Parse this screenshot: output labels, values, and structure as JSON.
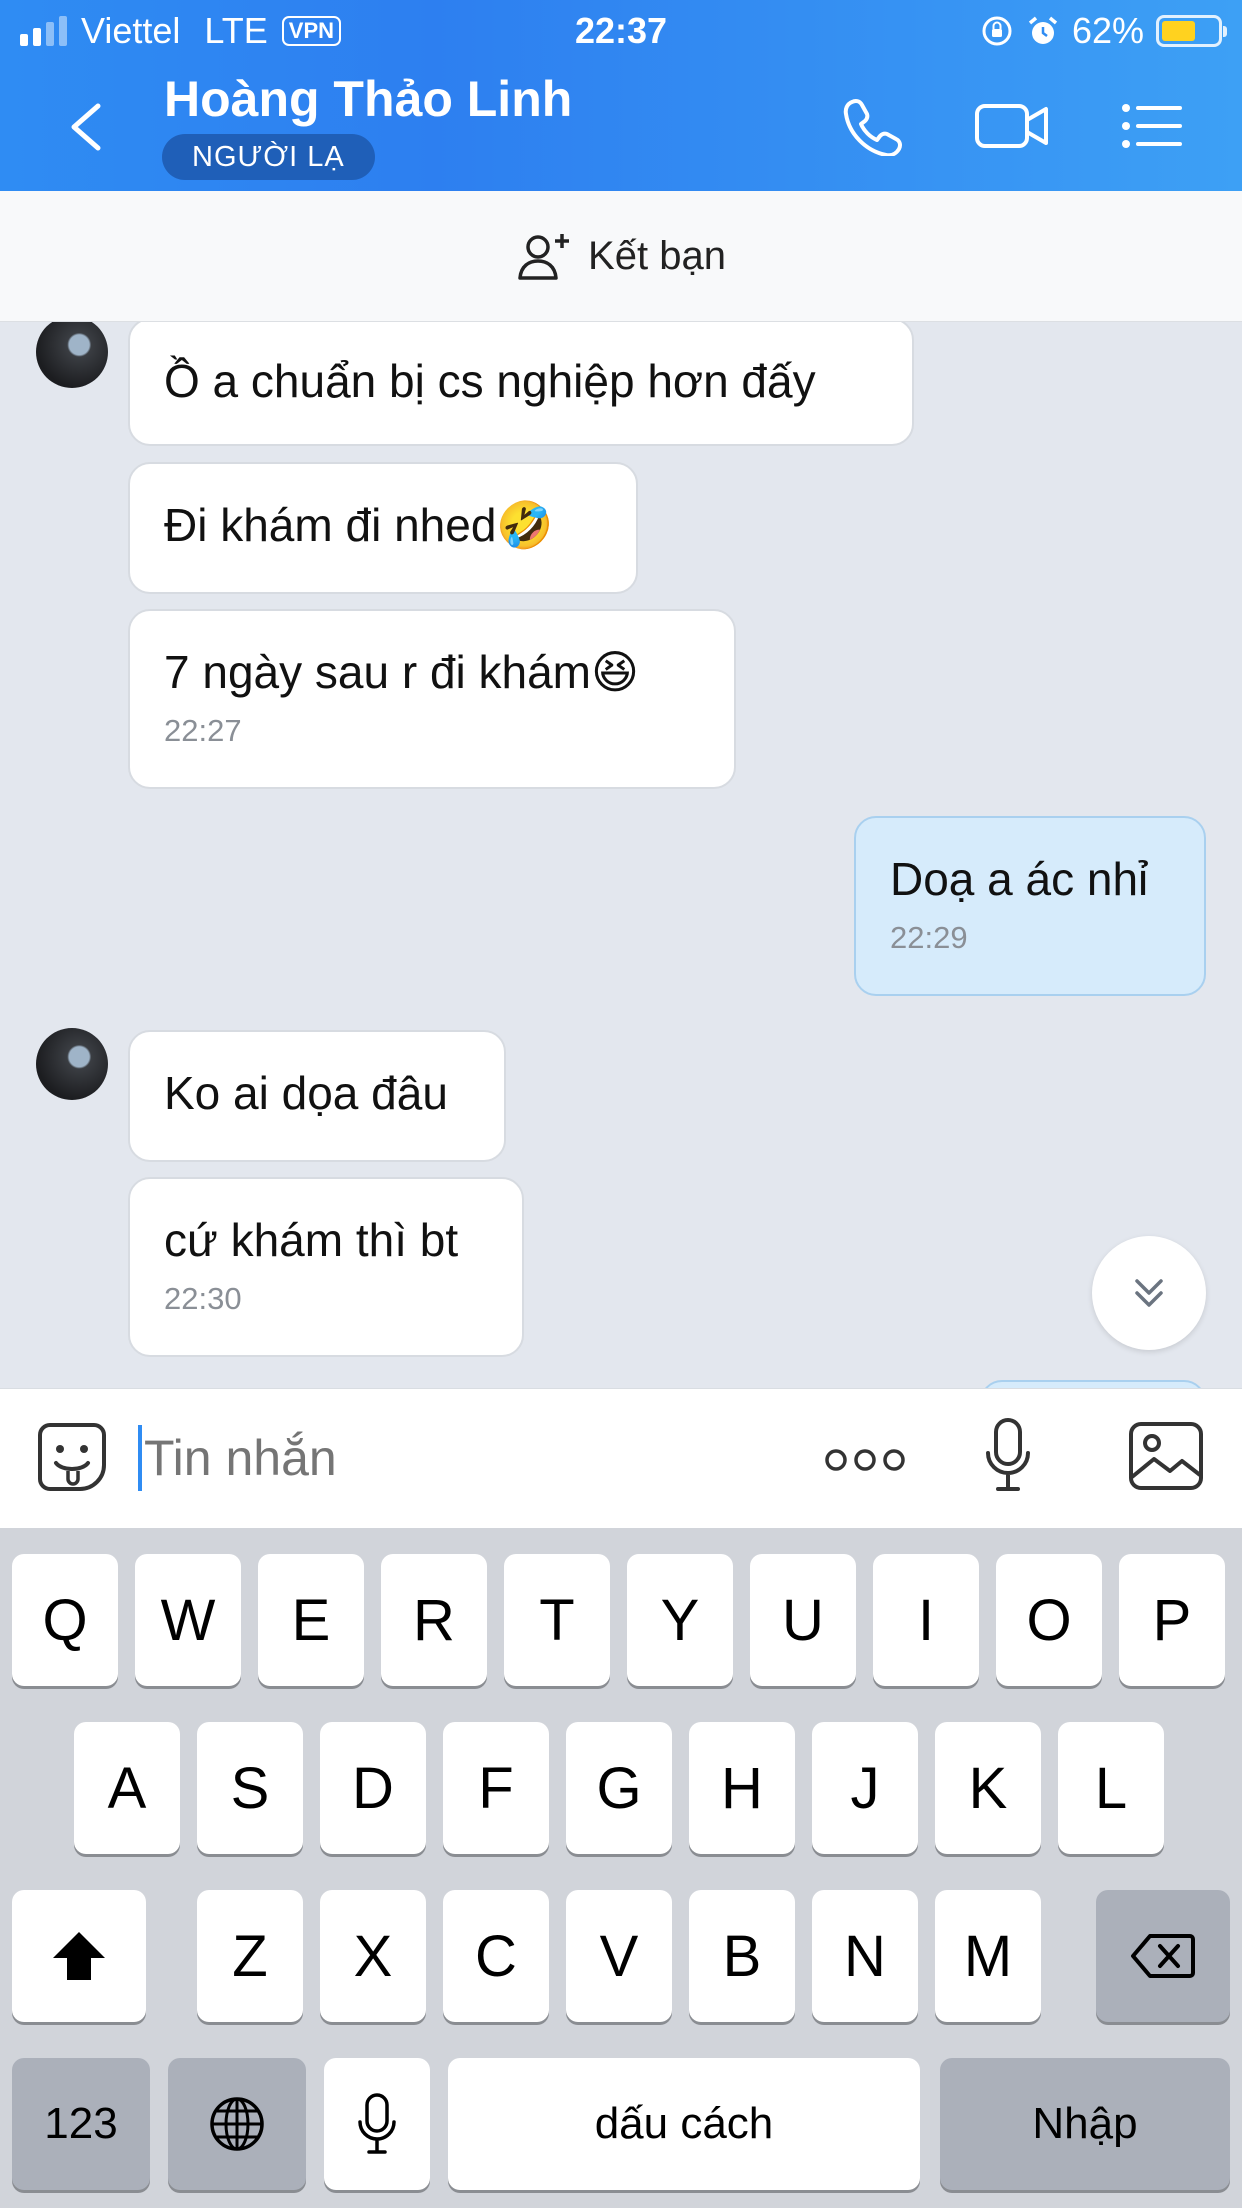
{
  "status_bar": {
    "carrier": "Viettel",
    "network": "LTE",
    "vpn": "VPN",
    "time": "22:37",
    "battery": "62%",
    "battery_level": 0.62
  },
  "header": {
    "contact_name": "Hoàng Thảo Linh",
    "badge": "NGƯỜI LẠ",
    "icons": [
      "back-icon",
      "phone-icon",
      "video-call-icon",
      "menu-list-icon"
    ]
  },
  "add_friend": {
    "label": "Kết bạn",
    "icon": "add-person-icon"
  },
  "messages": [
    {
      "sender": "them",
      "text": "Ồ a chuẩn bị cs nghiệp hơn đấy",
      "time": ""
    },
    {
      "sender": "them",
      "text": "Đi khám đi nhed🤣",
      "time": ""
    },
    {
      "sender": "them",
      "text": "7 ngày sau r đi khám😆",
      "time": "22:27"
    },
    {
      "sender": "me",
      "text": "Doạ a ác nhỉ",
      "time": "22:29"
    },
    {
      "sender": "them",
      "text": "Ko ai dọa đâu",
      "time": ""
    },
    {
      "sender": "them",
      "text": "cứ khám thì bt",
      "time": "22:30"
    }
  ],
  "input": {
    "placeholder": "Tin nhắn",
    "icons": [
      "sticker-icon",
      "more-icon",
      "microphone-icon",
      "image-icon"
    ]
  },
  "keyboard": {
    "row1": [
      "Q",
      "W",
      "E",
      "R",
      "T",
      "Y",
      "U",
      "I",
      "O",
      "P"
    ],
    "row2": [
      "A",
      "S",
      "D",
      "F",
      "G",
      "H",
      "J",
      "K",
      "L"
    ],
    "row3": [
      "Z",
      "X",
      "C",
      "V",
      "B",
      "N",
      "M"
    ],
    "numbers_key": "123",
    "space_key": "dấu cách",
    "return_key": "Nhập"
  },
  "colors": {
    "header_blue": "#2f8cf3",
    "my_bubble": "#d6ebfb",
    "chat_bg": "#e3e7ee",
    "battery": "#ffd21f"
  }
}
